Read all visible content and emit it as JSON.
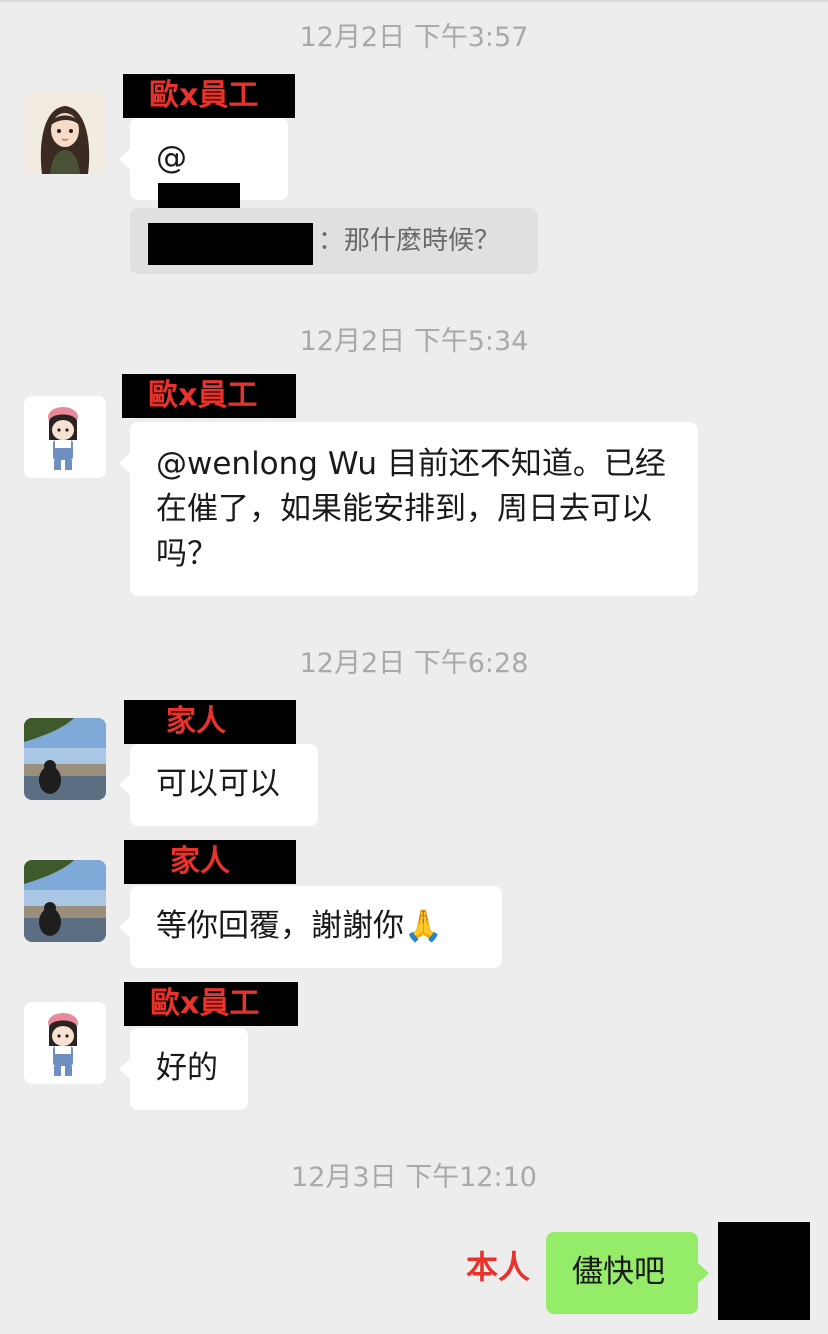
{
  "timestamps": [
    "12月2日 下午3:57",
    "12月2日 下午5:34",
    "12月2日 下午6:28",
    "12月3日 下午12:10"
  ],
  "senders": {
    "employee": "歐x員工",
    "family": "家人",
    "self": "本人"
  },
  "messages": {
    "m1_mention": "@",
    "m1_quote_text": "：那什麼時候？",
    "m2_text": "@wenlong Wu 目前还不知道。已经在催了，如果能安排到，周日去可以吗？",
    "m3_text": "可以可以",
    "m4_text": "等你回覆，謝謝你🙏",
    "m5_text": "好的",
    "m6_text": "儘快吧"
  },
  "colors": {
    "background": "#ededed",
    "bubble_incoming": "#ffffff",
    "bubble_outgoing": "#95ec69",
    "name_tag_text": "#e8322b",
    "timestamp_text": "#a9a9a9"
  }
}
